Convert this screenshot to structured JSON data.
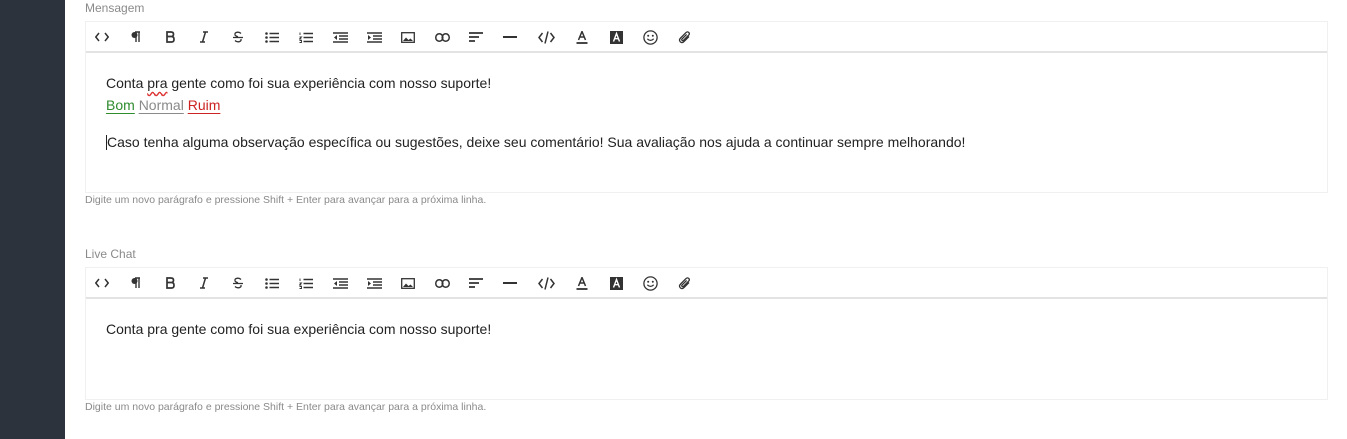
{
  "message_editor": {
    "label": "Mensagem",
    "line1_before": "Conta ",
    "line1_spell": "pra",
    "line1_after": " gente como foi sua experiência com nosso suporte!",
    "rating": [
      {
        "label": "Bom",
        "color": "#2e8b2e"
      },
      {
        "label": "Normal",
        "color": "#8a8a8a"
      },
      {
        "label": "Ruim",
        "color": "#cc2222"
      }
    ],
    "line2": "Caso tenha alguma observação específica ou sugestões, deixe seu comentário! Sua avaliação nos ajuda a continuar sempre melhorando!",
    "hint": "Digite um novo parágrafo e pressione Shift + Enter para avançar para a próxima linha."
  },
  "livechat_editor": {
    "label": "Live Chat",
    "line1": "Conta pra gente como foi sua experiência com nosso suporte!",
    "hint": "Digite um novo parágrafo e pressione Shift + Enter para avançar para a próxima linha."
  },
  "toolbar_icons": [
    "code-view-icon",
    "paragraph-icon",
    "bold-icon",
    "italic-icon",
    "strikethrough-icon",
    "bullet-list-icon",
    "numbered-list-icon",
    "outdent-icon",
    "indent-icon",
    "image-icon",
    "link-icon",
    "align-icon",
    "horizontal-rule-icon",
    "code-icon",
    "text-color-icon",
    "background-color-icon",
    "emoji-icon",
    "attachment-icon"
  ]
}
